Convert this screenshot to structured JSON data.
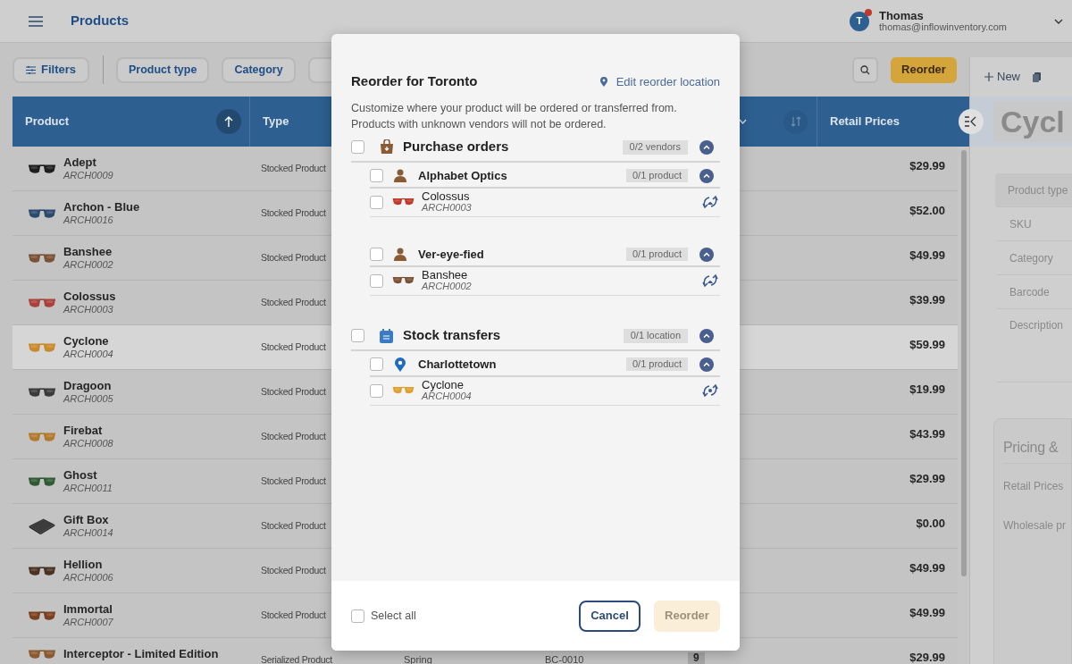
{
  "header": {
    "title": "Products",
    "user": {
      "initial": "T",
      "name": "Thomas",
      "email": "thomas@inflowinventory.com",
      "notification": true
    }
  },
  "toolbar": {
    "filters": "Filters",
    "chips": [
      "Product type",
      "Category"
    ],
    "reorder": "Reorder"
  },
  "table": {
    "columns": [
      {
        "label": "Product"
      },
      {
        "label": "Type"
      },
      {
        "label": "Retail Prices"
      }
    ],
    "rows": [
      {
        "name": "Adept",
        "sku": "ARCH0009",
        "type": "Stocked Product",
        "price": "$29.99",
        "selected": false,
        "thumbnail": {
          "kind": "glasses",
          "color": "#1e1e1e"
        }
      },
      {
        "name": "Archon - Blue",
        "sku": "ARCH0016",
        "type": "Stocked Product",
        "price": "$52.00",
        "selected": false,
        "thumbnail": {
          "kind": "glasses",
          "color": "#2d4a6e"
        }
      },
      {
        "name": "Banshee",
        "sku": "ARCH0002",
        "type": "Stocked Product",
        "price": "$49.99",
        "selected": false,
        "thumbnail": {
          "kind": "glasses",
          "color": "#7a5236"
        }
      },
      {
        "name": "Colossus",
        "sku": "ARCH0003",
        "type": "Stocked Product",
        "price": "$39.99",
        "selected": false,
        "thumbnail": {
          "kind": "glasses",
          "color": "#a8423a"
        }
      },
      {
        "name": "Cyclone",
        "sku": "ARCH0004",
        "type": "Stocked Product",
        "price": "$59.99",
        "selected": true,
        "thumbnail": {
          "kind": "glasses",
          "color": "#c98a2c"
        }
      },
      {
        "name": "Dragoon",
        "sku": "ARCH0005",
        "type": "Stocked Product",
        "price": "$19.99",
        "selected": false,
        "thumbnail": {
          "kind": "glasses",
          "color": "#3a3a3a"
        }
      },
      {
        "name": "Firebat",
        "sku": "ARCH0008",
        "type": "Stocked Product",
        "price": "$43.99",
        "selected": false,
        "thumbnail": {
          "kind": "glasses",
          "color": "#b27a2e"
        }
      },
      {
        "name": "Ghost",
        "sku": "ARCH0011",
        "type": "Stocked Product",
        "price": "$29.99",
        "selected": false,
        "thumbnail": {
          "kind": "glasses",
          "color": "#2f5a34"
        }
      },
      {
        "name": "Gift Box",
        "sku": "ARCH0014",
        "type": "Stocked Product",
        "price": "$0.00",
        "selected": false,
        "thumbnail": {
          "kind": "box",
          "color": "#3c3c3c"
        }
      },
      {
        "name": "Hellion",
        "sku": "ARCH0006",
        "type": "Stocked Product",
        "price": "$49.99",
        "selected": false,
        "thumbnail": {
          "kind": "glasses",
          "color": "#4a3222"
        }
      },
      {
        "name": "Immortal",
        "sku": "ARCH0007",
        "type": "Stocked Product",
        "price": "$49.99",
        "selected": false,
        "thumbnail": {
          "kind": "glasses",
          "color": "#7a4020"
        }
      },
      {
        "name": "Interceptor - Limited Edition",
        "type": "Serialized Product",
        "category": "Spring",
        "barcode": "BC-0010",
        "stock": "9",
        "price": "$29.99",
        "selected": false,
        "thumbnail": {
          "kind": "glasses",
          "color": "#8a5a30"
        }
      }
    ]
  },
  "detail_panel": {
    "new": "New",
    "title": "Cycl",
    "fields": [
      {
        "label": "Product type",
        "selected": true
      },
      {
        "label": "SKU",
        "selected": false
      },
      {
        "label": "Category",
        "selected": false
      },
      {
        "label": "Barcode",
        "selected": false
      },
      {
        "label": "Description",
        "selected": false
      }
    ],
    "pricing": {
      "title": "Pricing &",
      "fields": [
        "Retail Prices",
        "Wholesale pr"
      ]
    }
  },
  "dialog": {
    "title": "Reorder for Toronto",
    "edit_link": "Edit reorder location",
    "description": "Customize where your product will be ordered or transferred from. Products with unknown vendors will not be ordered.",
    "sections": [
      {
        "kind": "purchase",
        "label": "Purchase orders",
        "count": "0/2 vendors",
        "checked": false,
        "expanded": true,
        "groups": [
          {
            "kind": "vendor",
            "label": "Alphabet Optics",
            "count": "0/1 product",
            "checked": false,
            "expanded": true,
            "items": [
              {
                "name": "Colossus",
                "sku": "ARCH0003",
                "checked": false,
                "thumbnail": {
                  "kind": "glasses",
                  "color": "#c0392b"
                }
              }
            ]
          },
          {
            "kind": "vendor",
            "label": "Ver-eye-fied",
            "count": "0/1 product",
            "checked": false,
            "expanded": true,
            "items": [
              {
                "name": "Banshee",
                "sku": "ARCH0002",
                "checked": false,
                "thumbnail": {
                  "kind": "glasses",
                  "color": "#7a5236"
                }
              }
            ]
          }
        ]
      },
      {
        "kind": "transfer",
        "label": "Stock transfers",
        "count": "0/1 location",
        "checked": false,
        "expanded": true,
        "groups": [
          {
            "kind": "location",
            "label": "Charlottetown",
            "count": "0/1 product",
            "checked": false,
            "expanded": true,
            "items": [
              {
                "name": "Cyclone",
                "sku": "ARCH0004",
                "checked": false,
                "thumbnail": {
                  "kind": "glasses",
                  "color": "#e0a030"
                }
              }
            ]
          }
        ]
      }
    ],
    "select_all": {
      "label": "Select all",
      "checked": false
    },
    "cancel": "Cancel",
    "reorder": {
      "label": "Reorder",
      "disabled": true
    }
  }
}
